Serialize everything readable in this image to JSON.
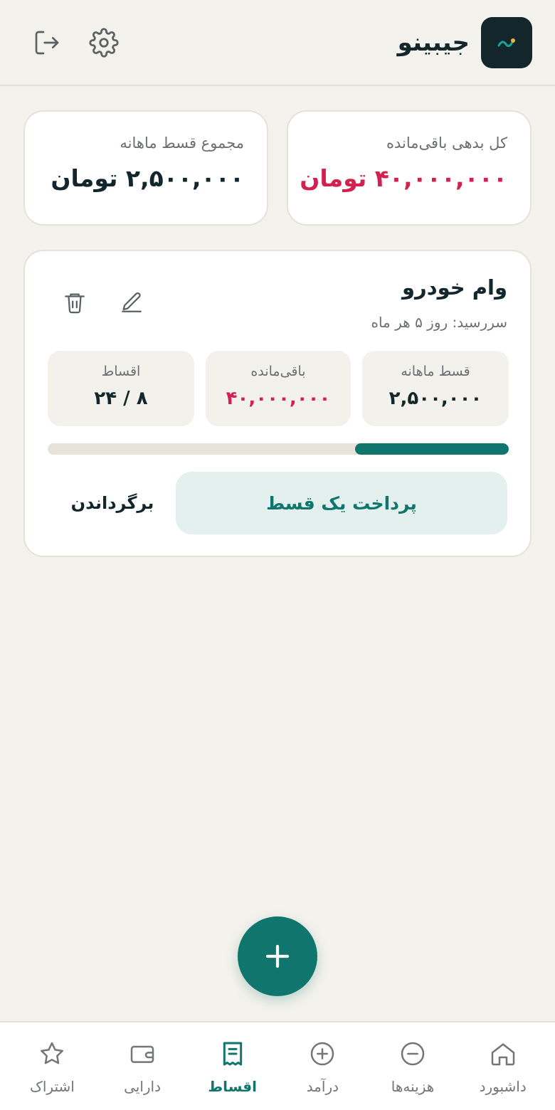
{
  "header": {
    "app_name": "جیبینو",
    "icons": [
      "logo-icon",
      "settings-icon",
      "logout-icon"
    ]
  },
  "summary": {
    "total_debt_label": "کل بدهی باقی‌مانده",
    "total_debt_value": "۴۰,۰۰۰,۰۰۰ تومان",
    "monthly_total_label": "مجموع قسط ماهانه",
    "monthly_total_value": "۲,۵۰۰,۰۰۰ تومان"
  },
  "loan": {
    "title": "وام خودرو",
    "due": "سررسید: روز ۵ هر ماه",
    "monthly_label": "قسط ماهانه",
    "monthly_value": "۲,۵۰۰,۰۰۰",
    "remaining_label": "باقی‌مانده",
    "remaining_value": "۴۰,۰۰۰,۰۰۰",
    "installments_label": "اقساط",
    "installments_value": "۸ / ۲۴",
    "progress_fraction": 0.333,
    "pay_button": "پرداخت یک قسط",
    "undo_button": "برگرداندن"
  },
  "nav": {
    "items": [
      {
        "label": "داشبورد",
        "icon": "home-icon"
      },
      {
        "label": "هزینه‌ها",
        "icon": "minus-circle-icon"
      },
      {
        "label": "درآمد",
        "icon": "plus-circle-icon"
      },
      {
        "label": "اقساط",
        "icon": "receipt-icon"
      },
      {
        "label": "دارایی",
        "icon": "wallet-icon"
      },
      {
        "label": "اشتراک",
        "icon": "star-icon"
      }
    ],
    "active_index": 3
  },
  "colors": {
    "primary": "#10756d",
    "danger": "#d3204f",
    "dark": "#12262c",
    "background": "#f4f2ec"
  }
}
